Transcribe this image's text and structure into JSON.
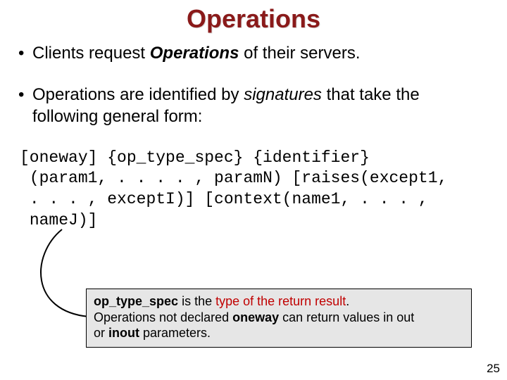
{
  "title": "Operations",
  "bullet1": {
    "pre": "Clients request ",
    "ops": "Operations",
    "post": " of their servers."
  },
  "bullet2": {
    "pre": "Operations are identified by ",
    "sig": "signatures",
    "post": " that take the following general form:"
  },
  "code": "[oneway] {op_type_spec} {identifier}\n (param1, . . . . , paramN) [raises(except1,\n . . . , exceptI)] [context(name1, . . . ,\n nameJ)]",
  "callout": {
    "l1": {
      "ots": "op_type_spec",
      "mid": " is the ",
      "typeof": "type of the return result",
      "end": "."
    },
    "l2": {
      "pre": "Operations not declared ",
      "oneway": "oneway",
      "post": " can return values in ",
      "out": "out"
    },
    "l3": {
      "pre": "or ",
      "inout": "inout",
      "post": " parameters."
    }
  },
  "pageNumber": "25"
}
